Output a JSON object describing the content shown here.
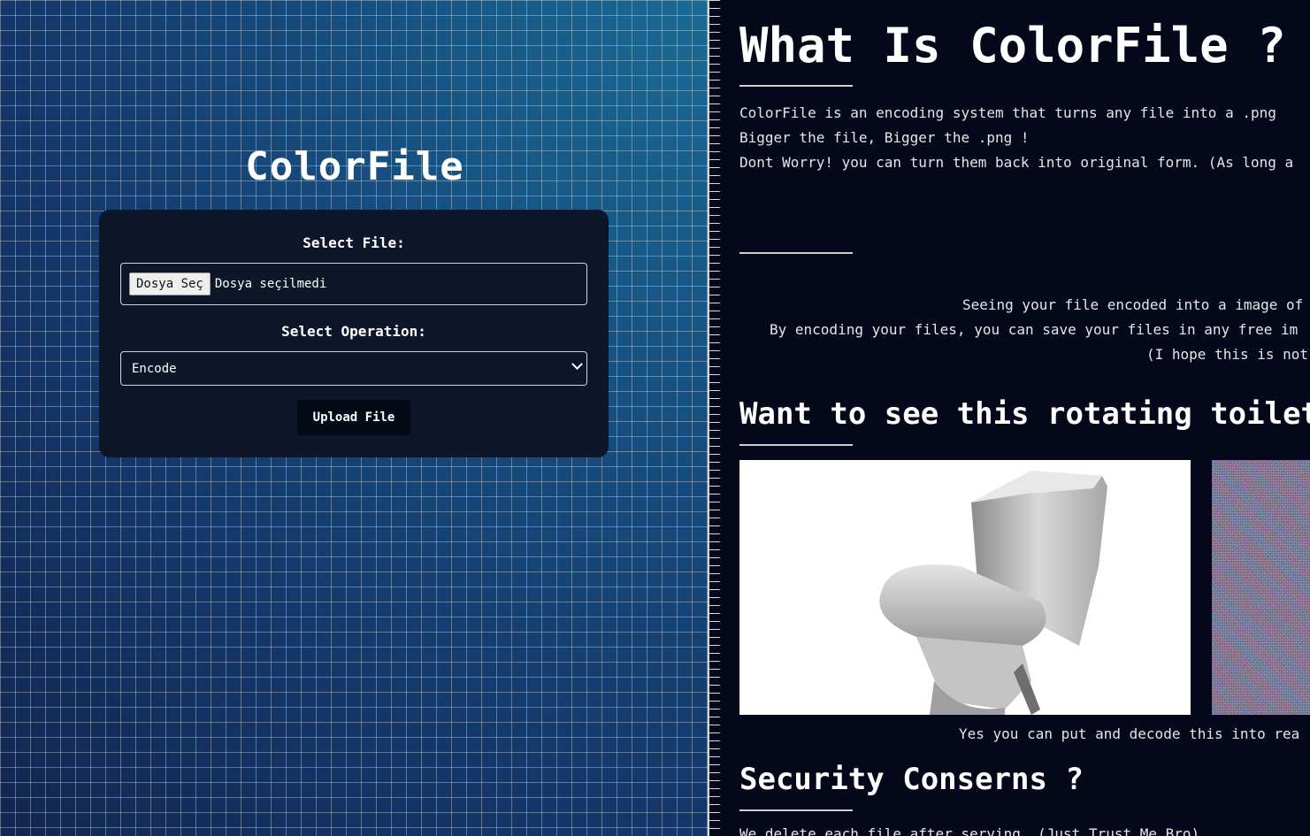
{
  "left": {
    "title": "ColorFile",
    "form": {
      "file_label": "Select File:",
      "file_button": "Dosya Seç",
      "file_status": "Dosya seçilmedi",
      "operation_label": "Select Operation:",
      "operation_selected": "Encode",
      "upload_button": "Upload File"
    }
  },
  "right": {
    "heading1": "What Is ColorFile ?",
    "intro_lines": [
      "ColorFile is an encoding system that turns any file into a .png",
      "Bigger the file, Bigger the .png !",
      "Dont Worry! you can turn them back into original form. (As long a"
    ],
    "center_lines": [
      "Seeing your file encoded into a image of",
      "By encoding your files, you can save your files in any free im",
      "(I hope this is not"
    ],
    "heading2": "Want to see this rotating toilet",
    "caption": "Yes you can put and decode this into rea",
    "heading3": "Security Conserns ?",
    "security_line": "We delete each file after serving. (Just Trust Me Bro)"
  },
  "colors": {
    "page_bg": "#04081a",
    "card_bg": "#0e1629",
    "button_bg": "#050a17",
    "text": "#ffffff"
  },
  "icons": {
    "select_chevron": "chevron-down-icon",
    "toilet_image": "toilet-icon",
    "encoded_noise_image": "encoded-png-preview"
  }
}
